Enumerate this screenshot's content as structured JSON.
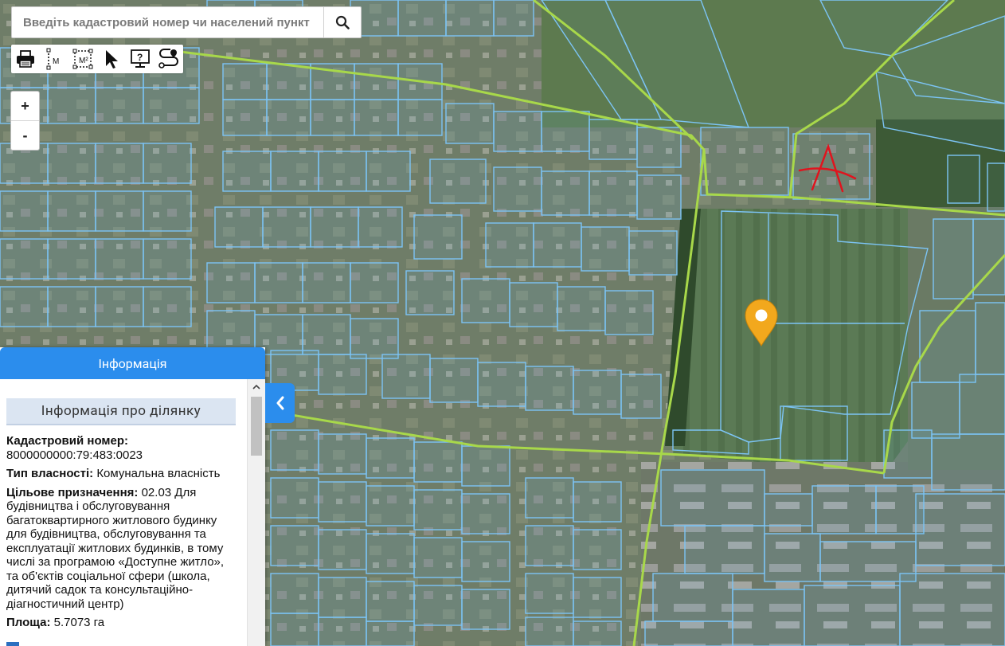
{
  "search": {
    "placeholder": "Введіть кадастровий номер чи населений пункт",
    "button_icon": "search-icon"
  },
  "toolbar": {
    "tools": [
      {
        "name": "print-tool",
        "icon": "printer-icon"
      },
      {
        "name": "measure-length-tool",
        "icon": "ruler-icon",
        "label": "M"
      },
      {
        "name": "measure-area-tool",
        "icon": "area-icon",
        "label": "M²"
      },
      {
        "name": "select-tool",
        "icon": "cursor-arrow-icon"
      },
      {
        "name": "info-tool",
        "icon": "info-query-icon"
      },
      {
        "name": "route-tool",
        "icon": "path-icon"
      }
    ]
  },
  "zoom": {
    "in_label": "+",
    "out_label": "-"
  },
  "panel": {
    "header": "Інформація",
    "subtitle": "Інформація про ділянку",
    "cadastral_label": "Кадастровий номер:",
    "cadastral_value": "8000000000:79:483:0023",
    "ownership_label": "Тип власності:",
    "ownership_value": " Комунальна власність",
    "purpose_label": "Цільове призначення:",
    "purpose_value": " 02.03 Для будівництва і обслуговування багатоквартирного житлового будинку для будівництва, обслуговування та експлуатації житлових будинків, в тому числі за програмою «Доступне житло», та об'єктів соціальної сфери (школа, дитячий садок та консультаційно-діагностичний центр)",
    "area_label": "Площа:",
    "area_value": " 5.7073 га"
  },
  "map": {
    "annotation_text": "A",
    "colors": {
      "parcel_border": "#7cc4f5",
      "road_line": "#a8d84a",
      "marker": "#f2a81d",
      "annotation": "#e0141e",
      "accent": "#2b8ded"
    }
  }
}
